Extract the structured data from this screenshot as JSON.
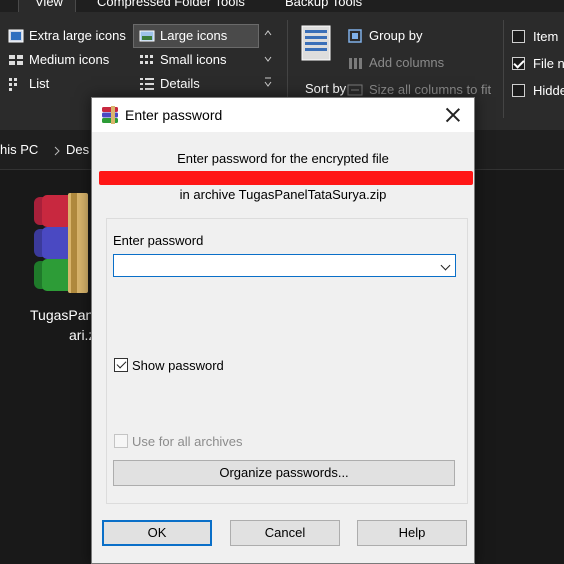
{
  "ribbon": {
    "tabs": [
      {
        "label": "View"
      },
      {
        "label": "Compressed Folder Tools"
      },
      {
        "label": "Backup Tools"
      }
    ],
    "layout_options": [
      {
        "label": "Extra large icons",
        "icon": "extra-large-icons-icon"
      },
      {
        "label": "Large icons",
        "icon": "large-icons-icon",
        "selected": true
      },
      {
        "label": "Medium icons",
        "icon": "medium-icons-icon"
      },
      {
        "label": "Small icons",
        "icon": "small-icons-icon"
      },
      {
        "label": "List",
        "icon": "list-icon"
      },
      {
        "label": "Details",
        "icon": "details-icon"
      }
    ],
    "sort_by": "Sort by",
    "group_by": "Group by",
    "add_columns": "Add columns",
    "size_columns": "Size all columns to fit",
    "checkboxes": [
      {
        "label": "Item",
        "checked": false
      },
      {
        "label": "File na",
        "checked": true
      },
      {
        "label": "Hidde",
        "checked": false
      }
    ]
  },
  "address": {
    "crumb1": "his PC",
    "crumb2": "Des"
  },
  "file": {
    "name_line1": "TugasPan",
    "name_line2": "ari.z"
  },
  "dialog": {
    "title": "Enter password",
    "line1": "Enter password for the encrypted file",
    "line3": "in archive TugasPanelTataSurya.zip",
    "field_label": "Enter password",
    "password_value": "",
    "show_password_label": "Show password",
    "show_password_checked": true,
    "use_all_label": "Use for all archives",
    "use_all_checked": false,
    "organize_label": "Organize passwords...",
    "ok_label": "OK",
    "cancel_label": "Cancel",
    "help_label": "Help"
  },
  "colors": {
    "accent": "#0a6fc8",
    "redaction": "#ff1616",
    "explorer_bg": "#191919",
    "ribbon_bg": "#2b2b2b",
    "dialog_bg": "#f0f0f0"
  }
}
